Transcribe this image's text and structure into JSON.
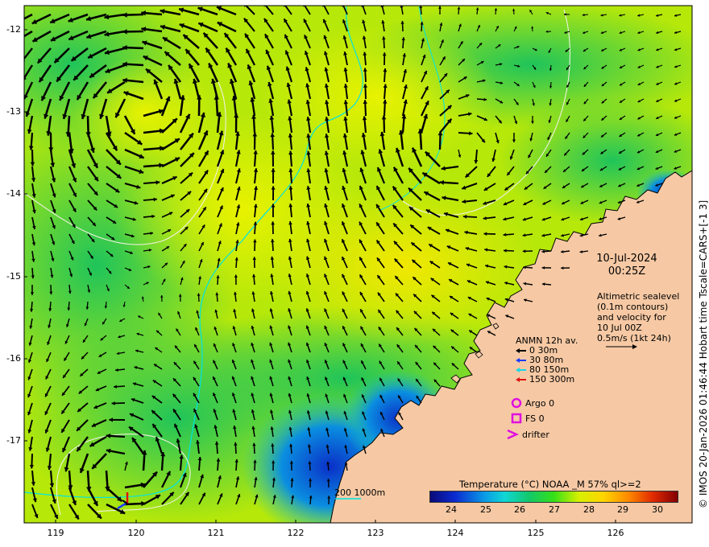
{
  "map": {
    "lat_ticks": [
      "-12",
      "-13",
      "-14",
      "-15",
      "-16",
      "-17"
    ],
    "lon_ticks": [
      "119",
      "120",
      "121",
      "122",
      "123",
      "124",
      "125",
      "126"
    ],
    "lat_range": [
      -17.95,
      -11.7
    ],
    "lon_range": [
      118.6,
      126.95
    ]
  },
  "date": "10-Jul-2024",
  "time": "00:25Z",
  "altimetry_lines": [
    "Altimetric sealevel",
    "(0.1m contours)",
    "and velocity for",
    "10 Jul 00Z",
    "0.5m/s (1kt 24h)"
  ],
  "legend": {
    "title": "ANMN 12h av.",
    "entries": [
      {
        "label": "0 30m",
        "color": "#000000"
      },
      {
        "label": "30 80m",
        "color": "#1a3cff"
      },
      {
        "label": "80 150m",
        "color": "#17d7e6"
      },
      {
        "label": "150 300m",
        "color": "#e01010"
      }
    ]
  },
  "markers": [
    {
      "label": "Argo 0",
      "color": "#e010e0"
    },
    {
      "label": "FS 0",
      "color": "#e010e0"
    },
    {
      "label": "drifter",
      "color": "#e010e0"
    }
  ],
  "colorbar": {
    "title": "Temperature (°C) NOAA _M 57% ql>=2",
    "ticks": [
      "24",
      "25",
      "26",
      "27",
      "28",
      "29",
      "30"
    ],
    "range": [
      23.5,
      30.7
    ]
  },
  "scale_label": "200  1000m",
  "side_caption": "© IMOS 20-Jan-2026 01:46:44 Hobart time Tscale=CARS+[-1 3]",
  "colors": {
    "land": "#f6c9a4",
    "ocean_warm": "#d4ef04",
    "ocean_cool": "#3fd316",
    "shelf_contour": "#00e4e4"
  }
}
